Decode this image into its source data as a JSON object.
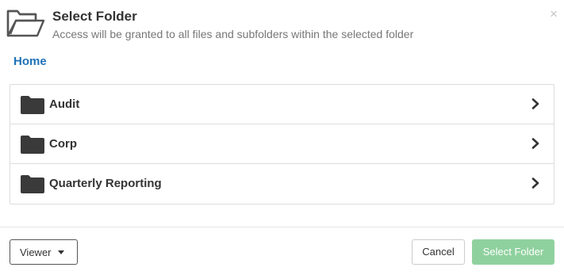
{
  "dialog": {
    "header_icon": "folder-open-outline-icon",
    "title": "Select Folder",
    "subtitle": "Access will be granted to all files and subfolders within the selected folder",
    "close_label": "×"
  },
  "breadcrumb": {
    "items": [
      "Home"
    ]
  },
  "folders": {
    "icon": "folder-icon",
    "chevron_icon": "chevron-right-icon",
    "items": [
      {
        "name": "Audit"
      },
      {
        "name": "Corp"
      },
      {
        "name": "Quarterly Reporting"
      }
    ]
  },
  "footer": {
    "role_select": {
      "value": "Viewer",
      "icon": "caret-down-icon"
    },
    "cancel_label": "Cancel",
    "select_label": "Select Folder",
    "select_enabled": false
  },
  "colors": {
    "link": "#1f72b8",
    "primary_disabled": "#8fd19e",
    "folder": "#3a3a3a",
    "border": "#dddddd"
  }
}
